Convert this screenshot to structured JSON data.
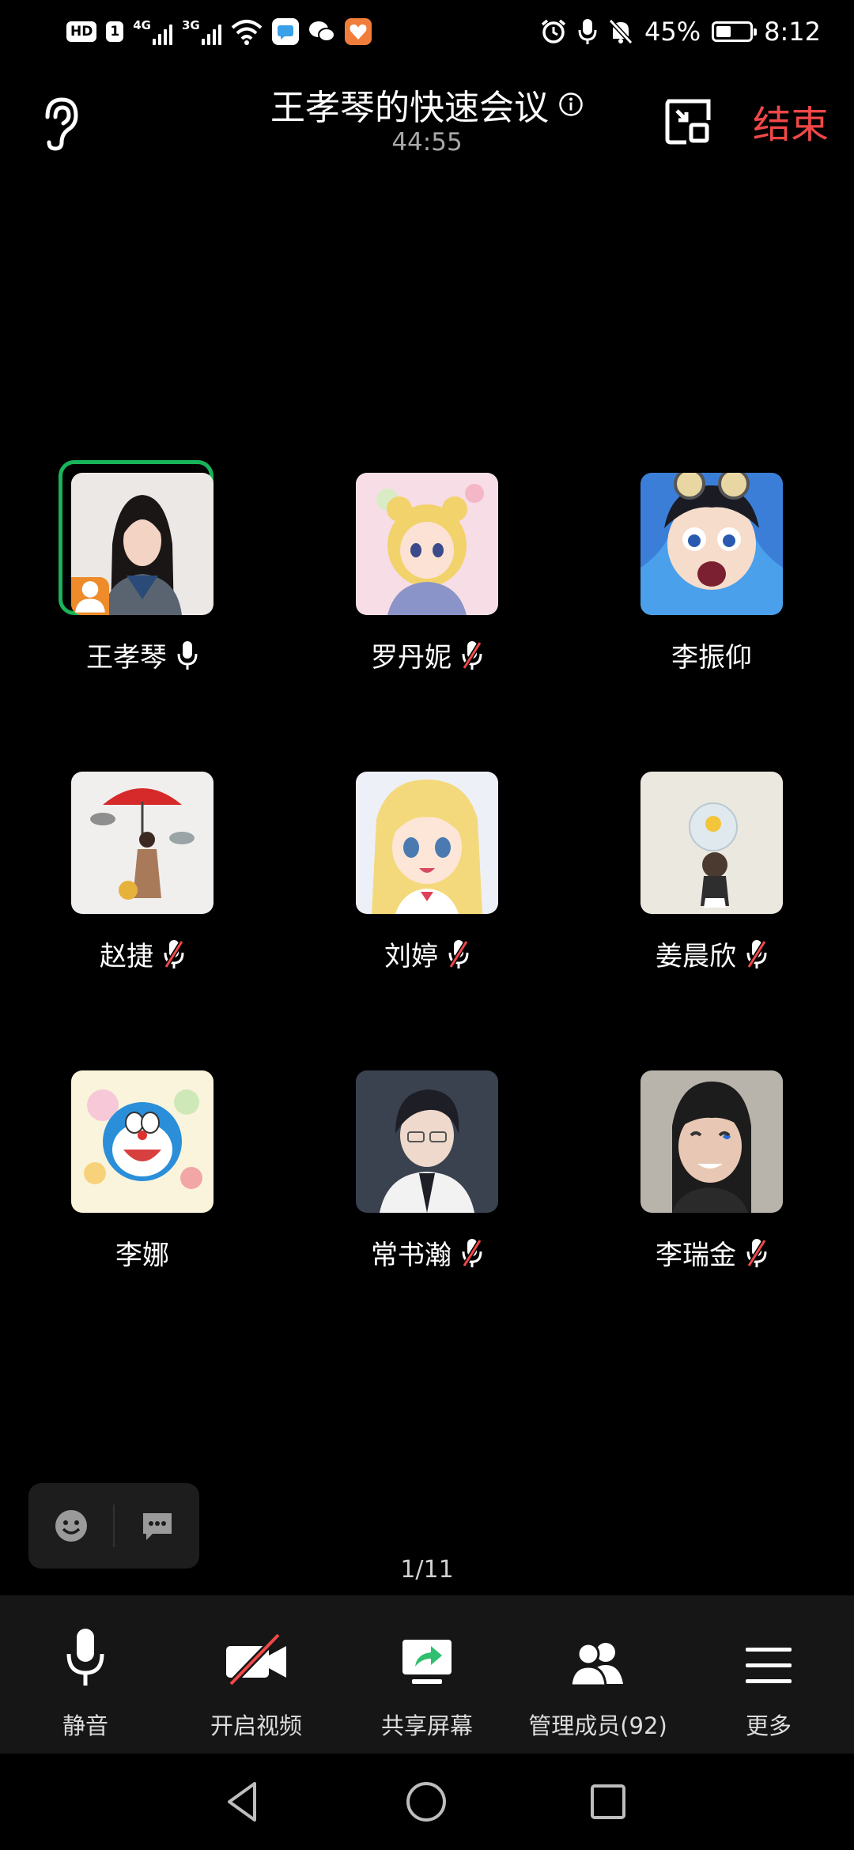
{
  "status_bar": {
    "hd": "HD",
    "sim1": "1",
    "net1": "4G",
    "net2": "3G",
    "battery_percent": "45%",
    "battery_level": 0.45,
    "time": "8:12"
  },
  "header": {
    "title": "王孝琴的快速会议",
    "timer": "44:55",
    "end_label": "结束"
  },
  "participants": [
    {
      "name": "王孝琴",
      "mic": "on",
      "host": true
    },
    {
      "name": "罗丹妮",
      "mic": "muted",
      "host": false
    },
    {
      "name": "李振仰",
      "mic": "none",
      "host": false
    },
    {
      "name": "赵捷",
      "mic": "muted",
      "host": false
    },
    {
      "name": "刘婷",
      "mic": "muted",
      "host": false
    },
    {
      "name": "姜晨欣",
      "mic": "muted",
      "host": false
    },
    {
      "name": "李娜",
      "mic": "none",
      "host": false
    },
    {
      "name": "常书瀚",
      "mic": "muted",
      "host": false
    },
    {
      "name": "李瑞金",
      "mic": "muted",
      "host": false
    }
  ],
  "page_indicator": "1/11",
  "toolbar": {
    "mute": "静音",
    "video": "开启视频",
    "share": "共享屏幕",
    "members": "管理成员(92)",
    "more": "更多"
  },
  "colors": {
    "end": "#f04848",
    "host_ring": "#19b45a",
    "host_badge": "#ee8b2a",
    "mute_slash": "#f04848"
  }
}
